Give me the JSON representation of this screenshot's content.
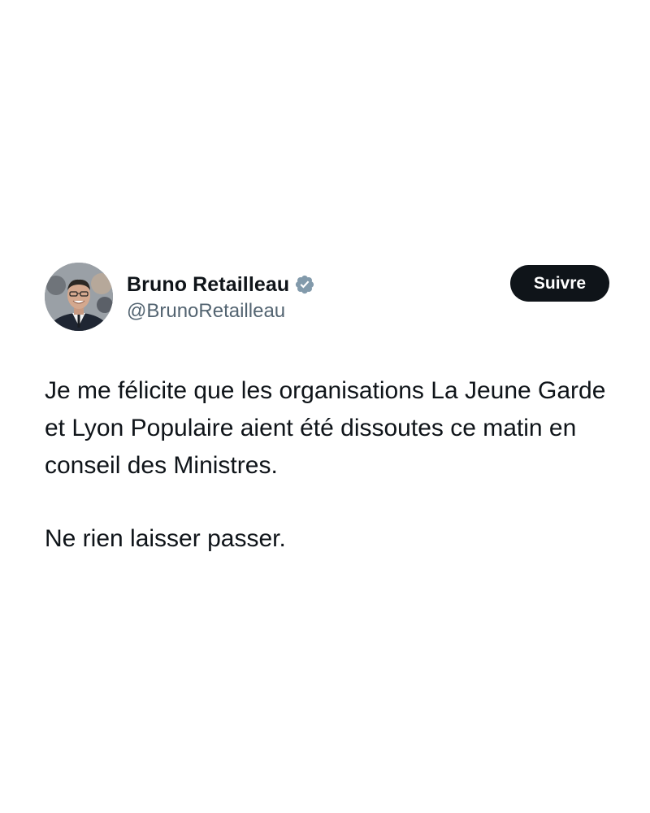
{
  "tweet": {
    "author": {
      "display_name": "Bruno Retailleau",
      "handle": "@BrunoRetailleau",
      "verified": true,
      "avatar_icon": "profile-photo"
    },
    "follow_button_label": "Suivre",
    "body": {
      "paragraph_1": "Je me félicite que les organisations La Jeune Garde et Lyon Populaire aient été dissoutes ce matin en conseil des Ministres.",
      "paragraph_2": "Ne rien laisser passer."
    }
  },
  "colors": {
    "background": "#ffffff",
    "text": "#0f1419",
    "secondary_text": "#536471",
    "button_bg": "#0f1419",
    "button_text": "#ffffff",
    "verified_badge": "#829aab"
  }
}
